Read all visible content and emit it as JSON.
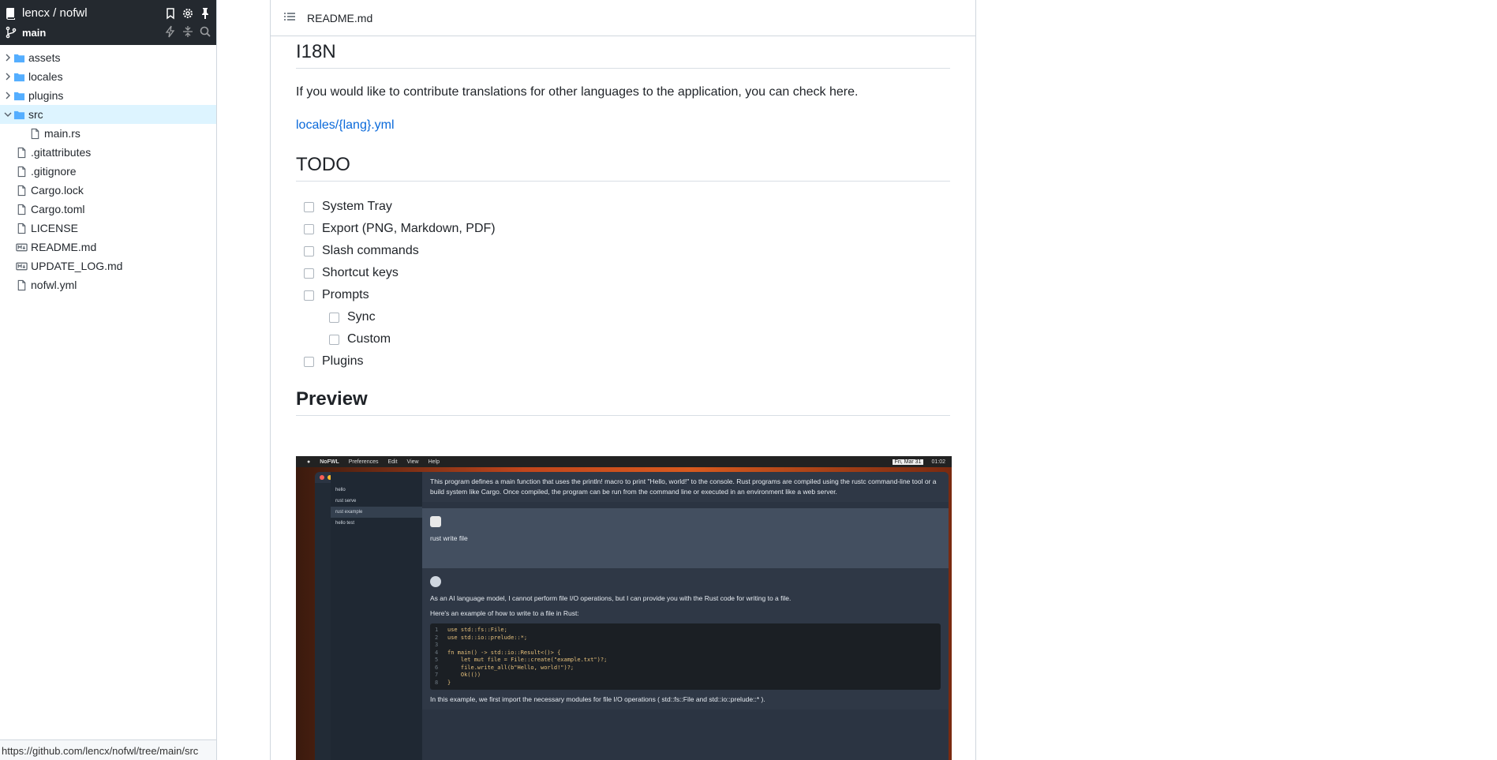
{
  "sidebar": {
    "repo": "lencx / nofwl",
    "branch": "main",
    "tree": [
      {
        "name": "assets",
        "type": "folder",
        "expanded": false
      },
      {
        "name": "locales",
        "type": "folder",
        "expanded": false
      },
      {
        "name": "plugins",
        "type": "folder",
        "expanded": false
      },
      {
        "name": "src",
        "type": "folder",
        "expanded": true
      },
      {
        "name": "main.rs",
        "type": "file",
        "child": true
      },
      {
        "name": ".gitattributes",
        "type": "file"
      },
      {
        "name": ".gitignore",
        "type": "file"
      },
      {
        "name": "Cargo.lock",
        "type": "file"
      },
      {
        "name": "Cargo.toml",
        "type": "file"
      },
      {
        "name": "LICENSE",
        "type": "file"
      },
      {
        "name": "README.md",
        "type": "markdown"
      },
      {
        "name": "UPDATE_LOG.md",
        "type": "markdown"
      },
      {
        "name": "nofwl.yml",
        "type": "file"
      }
    ],
    "status_url": "https://github.com/lencx/nofwl/tree/main/src"
  },
  "readme": {
    "filename": "README.md",
    "i18n_heading": "I18N",
    "i18n_text": "If you would like to contribute translations for other languages to the application, you can check here.",
    "i18n_link": "locales/{lang}.yml",
    "todo_heading": "TODO",
    "todo": [
      {
        "label": "System Tray",
        "checked": false
      },
      {
        "label": "Export (PNG, Markdown, PDF)",
        "checked": false
      },
      {
        "label": "Slash commands",
        "checked": false
      },
      {
        "label": "Shortcut keys",
        "checked": false
      },
      {
        "label": "Prompts",
        "checked": false
      },
      {
        "label": "Sync",
        "checked": false,
        "sub": true
      },
      {
        "label": "Custom",
        "checked": false,
        "sub": true
      },
      {
        "label": "Plugins",
        "checked": false
      }
    ],
    "preview_heading": "Preview"
  },
  "preview": {
    "menubar": {
      "app": "NoFWL",
      "items": [
        "Preferences",
        "Edit",
        "View",
        "Help"
      ],
      "date": "Fri, Mar 31",
      "time": "01:02"
    },
    "chat_list": [
      "hello",
      "rust serve",
      "rust example",
      "hello test"
    ],
    "bot_text_1": "This program defines a main function that uses the println! macro to print \"Hello, world!\" to the console. Rust programs are compiled using the rustc command-line tool or a build system like Cargo. Once compiled, the program can be run from the command line or executed in an environment like a web server.",
    "user_text": "rust write file",
    "bot_text_2": "As an AI language model, I cannot perform file I/O operations, but I can provide you with the Rust code for writing to a file.",
    "bot_text_3": "Here's an example of how to write to a file in Rust:",
    "code": [
      "use std::fs::File;",
      "use std::io::prelude::*;",
      "",
      "fn main() -> std::io::Result<()> {",
      "    let mut file = File::create(\"example.txt\")?;",
      "    file.write_all(b\"Hello, world!\")?;",
      "    Ok(())",
      "}"
    ],
    "bot_text_4": "In this example, we first import the necessary modules for file I/O operations ( std::fs::File and std::io::prelude::* )."
  },
  "colors": {
    "sidebar_header": "#24292f",
    "selected_row": "#ddf4ff",
    "folder": "#54aeff",
    "link": "#0969da"
  }
}
